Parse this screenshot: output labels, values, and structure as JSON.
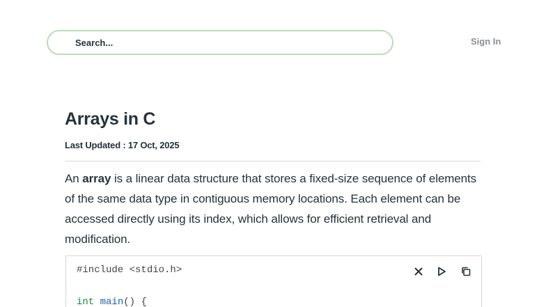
{
  "header": {
    "search_placeholder": "Search...",
    "signin_label": "Sign In"
  },
  "article": {
    "title": "Arrays in C",
    "last_updated": "Last Updated : 17 Oct, 2025",
    "intro": {
      "lead": "An ",
      "term": "array",
      "rest": " is a linear data structure that stores a fixed-size sequence of elements of the same data type in contiguous memory locations. Each element can be accessed directly using its index, which allows for efficient retrieval and modification."
    }
  },
  "code": {
    "line1": "#include <stdio.h>",
    "line2_keyword": "int",
    "line2_fn": "main",
    "line2_rest": "() {",
    "actions": [
      "close-icon",
      "run-icon",
      "copy-icon"
    ]
  },
  "colors": {
    "search_border": "#b9dcb6",
    "text": "#273239",
    "muted": "#8a8f93",
    "keyword": "#188a3f",
    "function": "#1a63a8"
  }
}
